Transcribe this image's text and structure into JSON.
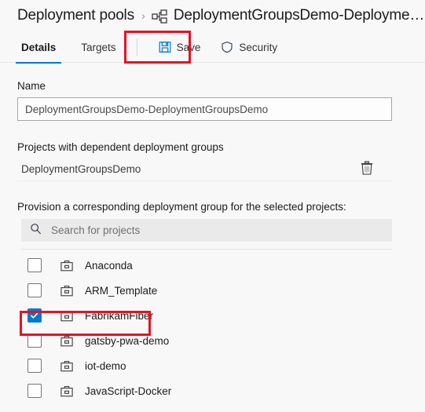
{
  "breadcrumb": {
    "root_label": "Deployment pools",
    "separator": "›",
    "current_icon": "deployment-group-icon",
    "current_label": "DeploymentGroupsDemo-Deployment..."
  },
  "command_bar": {
    "tabs": [
      {
        "label": "Details",
        "active": true
      },
      {
        "label": "Targets",
        "active": false
      }
    ],
    "save_label": "Save",
    "save_icon": "save-floppy-icon",
    "security_label": "Security",
    "security_icon": "shield-icon"
  },
  "form": {
    "name_label": "Name",
    "name_value": "DeploymentGroupsDemo-DeploymentGroupsDemo",
    "name_placeholder": "Name",
    "dependent_section_label": "Projects with dependent deployment groups",
    "dependent_projects": [
      {
        "name": "DeploymentGroupsDemo",
        "delete_icon": "trash-icon"
      }
    ],
    "provision_label": "Provision a corresponding deployment group for the selected projects:",
    "search": {
      "icon": "search-icon",
      "placeholder": "Search for projects",
      "value": ""
    },
    "projects": [
      {
        "name": "Anaconda",
        "checked": false,
        "icon": "project-briefcase-icon"
      },
      {
        "name": "ARM_Template",
        "checked": false,
        "icon": "project-briefcase-icon"
      },
      {
        "name": "FabrikamFiber",
        "checked": true,
        "icon": "project-briefcase-icon"
      },
      {
        "name": "gatsby-pwa-demo",
        "checked": false,
        "icon": "project-briefcase-icon"
      },
      {
        "name": "iot-demo",
        "checked": false,
        "icon": "project-briefcase-icon"
      },
      {
        "name": "JavaScript-Docker",
        "checked": false,
        "icon": "project-briefcase-icon"
      }
    ]
  },
  "annotations": {
    "highlight_color": "#e81123",
    "boxes": [
      {
        "target": "save-button"
      },
      {
        "target": "project-item-fabrikamfiber"
      }
    ]
  },
  "colors": {
    "accent": "#0078d4",
    "page_background": "#f8f8f8",
    "search_background": "#eaeaea",
    "highlight": "#e81123"
  }
}
